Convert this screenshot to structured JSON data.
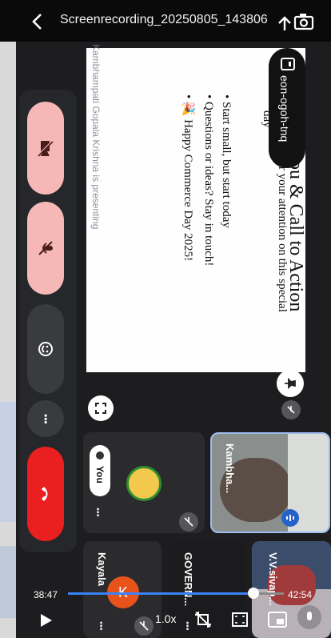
{
  "header": {
    "title": "Screenrecording_20250805_143806"
  },
  "meeting": {
    "meeting_code": "eon-ogoh-tnq",
    "presenter_caption": "Kambhampati Gopala Krishna is presenting",
    "slide": {
      "title": "ou & Call to Action",
      "bullets": [
        "Thank you for your attention on this special",
        "day",
        "Start small, but start today",
        "Questions or ideas? Stay in touch!",
        "Happy Commerce Day 2025!"
      ]
    },
    "participants": {
      "you": "You",
      "kambha": "Kambha...",
      "kayala": "Kayala",
      "kayala_initial": "K",
      "govern": "GOVERN...",
      "vv": "V.V.sivap..."
    },
    "more_symbol": "•••"
  },
  "player": {
    "current_time": "38:47",
    "total_time": "42:54",
    "progress": 0.86,
    "speed": "1.0x"
  },
  "colors": {
    "accent": "#3a82f7",
    "pink_button": "#f6b8b6",
    "end_call": "#ea1f1f"
  }
}
